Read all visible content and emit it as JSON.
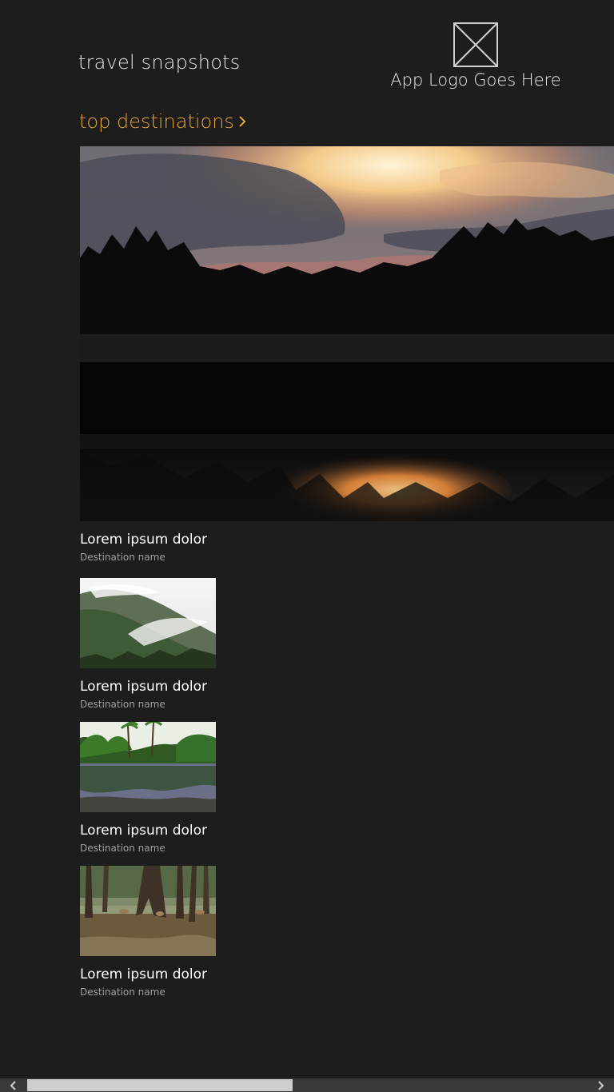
{
  "header": {
    "app_title": "travel snapshots",
    "logo_text": "App Logo Goes Here"
  },
  "section": {
    "link_label": "top destinations"
  },
  "hero": {
    "title": "Lorem ipsum dolor",
    "subtitle": "Destination name"
  },
  "items": [
    {
      "title": "Lorem ipsum dolor",
      "subtitle": "Destination name"
    },
    {
      "title": "Lorem ipsum dolor",
      "subtitle": "Destination name"
    },
    {
      "title": "Lorem ipsum dolor",
      "subtitle": "Destination name"
    }
  ],
  "colors": {
    "background": "#1d1d1d",
    "accent": "#e8a434",
    "subtitle": "#a0a0a0"
  },
  "icons": {
    "logo": "logo-placeholder-icon",
    "section_chevron": "chevron-right-icon",
    "scroll_left": "chevron-left-icon",
    "scroll_right": "chevron-right-icon"
  }
}
